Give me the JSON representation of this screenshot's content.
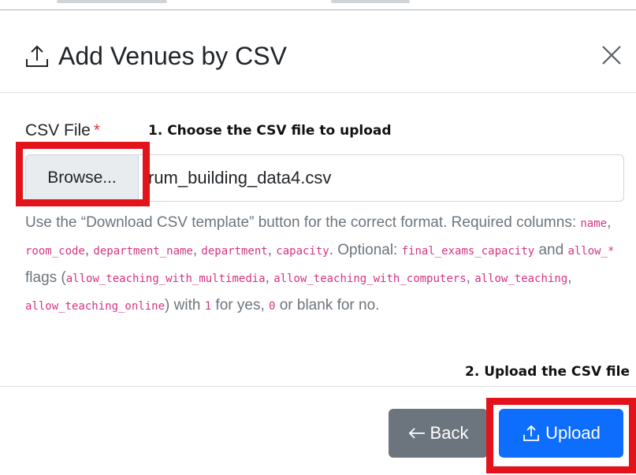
{
  "modal": {
    "title": "Add Venues by CSV",
    "title_icon": "upload-icon",
    "close_icon": "close-icon"
  },
  "form": {
    "field_label": "CSV File",
    "required_mark": "*",
    "browse_label": "Browse...",
    "file_name": "rum_building_data4.csv",
    "help": {
      "t1": "Use the “Download CSV template” button for the correct format. Required columns: ",
      "c1": "name",
      "s1": ", ",
      "c2": "room_code",
      "s2": ", ",
      "c3": "department_name",
      "s3": ", ",
      "c4": "department",
      "s4": ", ",
      "c5": "capacity",
      "t2": ". Optional: ",
      "c6": "final_exams_capacity",
      "t3": " and ",
      "c7": "allow_*",
      "t4": " flags (",
      "c8": "allow_teaching_with_multimedia",
      "s5": ", ",
      "c9": "allow_teaching_with_computers",
      "s6": ", ",
      "c10": "allow_teaching",
      "s7": ", ",
      "c11": "allow_teaching_online",
      "t5": ") with ",
      "c12": "1",
      "t6": " for yes, ",
      "c13": "0",
      "t7": " or blank for no."
    }
  },
  "annotations": {
    "step1": "1. Choose the CSV file to upload",
    "step2": "2. Upload the CSV file"
  },
  "footer": {
    "back_label": "Back",
    "back_icon": "arrow-left-icon",
    "upload_label": "Upload",
    "upload_icon": "upload-icon"
  },
  "colors": {
    "primary": "#0d6efd",
    "secondary": "#6c757d",
    "annotation_red": "#e3131b",
    "code_pink": "#d63384"
  }
}
